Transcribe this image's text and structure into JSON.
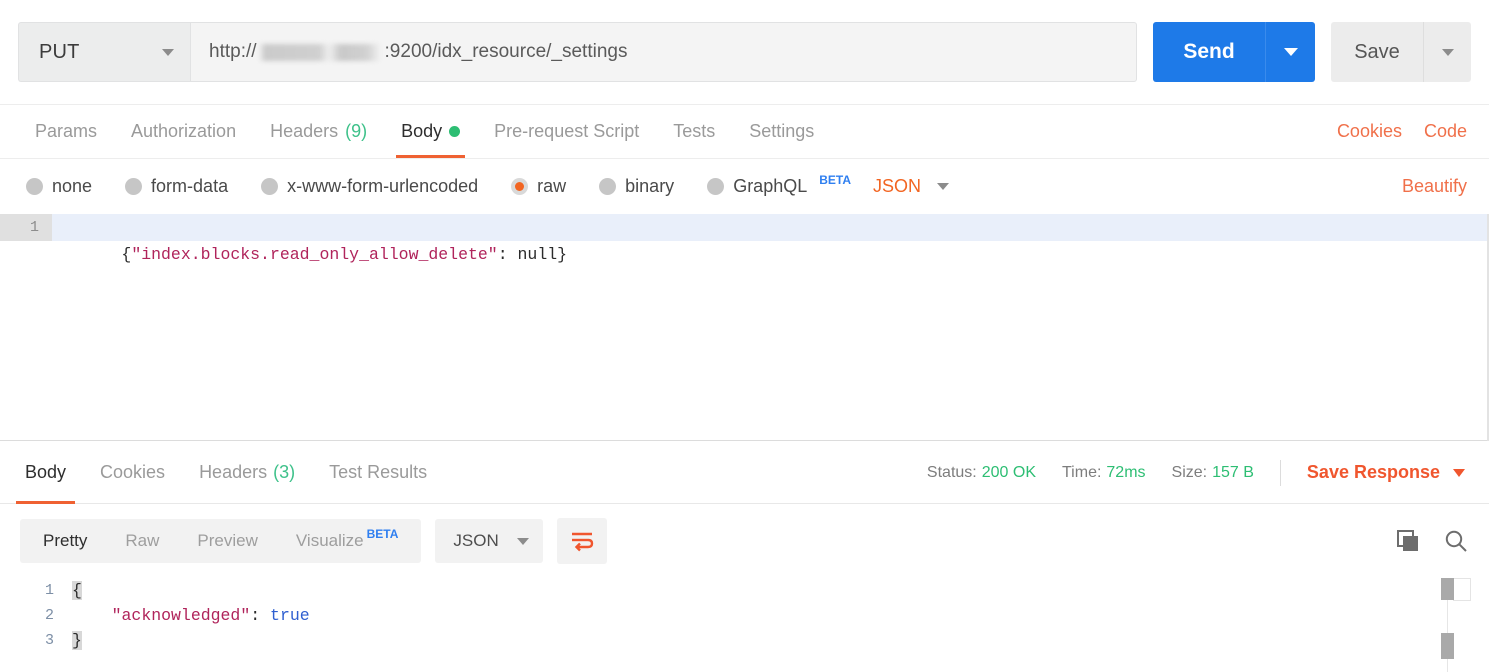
{
  "request_bar": {
    "method": "PUT",
    "method_caret_icon": "chevron-down-icon",
    "url_prefix": "http://",
    "url_suffix": ":9200/idx_resource/_settings",
    "url_placeholder": "Enter request URL",
    "send_label": "Send",
    "send_caret_icon": "chevron-down-icon",
    "save_label": "Save",
    "save_caret_icon": "chevron-down-icon"
  },
  "request_tabs": {
    "items": [
      {
        "label": "Params",
        "count": "",
        "active": false
      },
      {
        "label": "Authorization",
        "count": "",
        "active": false
      },
      {
        "label": "Headers",
        "count": "(9)",
        "active": false
      },
      {
        "label": "Body",
        "count": "",
        "active": true,
        "dot": true
      },
      {
        "label": "Pre-request Script",
        "count": "",
        "active": false
      },
      {
        "label": "Tests",
        "count": "",
        "active": false
      },
      {
        "label": "Settings",
        "count": "",
        "active": false
      }
    ],
    "cookies_label": "Cookies",
    "code_label": "Code"
  },
  "body_mode": {
    "options": [
      {
        "label": "none",
        "selected": false
      },
      {
        "label": "form-data",
        "selected": false
      },
      {
        "label": "x-www-form-urlencoded",
        "selected": false
      },
      {
        "label": "raw",
        "selected": true
      },
      {
        "label": "binary",
        "selected": false
      },
      {
        "label": "GraphQL",
        "selected": false,
        "badge": "BETA"
      }
    ],
    "format_label": "JSON",
    "format_caret_icon": "chevron-down-icon",
    "beautify_label": "Beautify"
  },
  "request_editor": {
    "lines": [
      {
        "number": "1",
        "active": true,
        "tokens": [
          {
            "text": "{",
            "type": "punct"
          },
          {
            "text": "\"index.blocks.read_only_allow_delete\"",
            "type": "string"
          },
          {
            "text": ":",
            "type": "punct"
          },
          {
            "text": " ",
            "type": "punct"
          },
          {
            "text": "null",
            "type": "null"
          },
          {
            "text": "}",
            "type": "punct"
          }
        ]
      }
    ]
  },
  "response_tabs": {
    "items": [
      {
        "label": "Body",
        "count": "",
        "active": true
      },
      {
        "label": "Cookies",
        "count": "",
        "active": false
      },
      {
        "label": "Headers",
        "count": "(3)",
        "active": false
      },
      {
        "label": "Test Results",
        "count": "",
        "active": false
      }
    ],
    "status_label": "Status:",
    "status_value": "200 OK",
    "time_label": "Time:",
    "time_value": "72ms",
    "size_label": "Size:",
    "size_value": "157 B",
    "save_response_label": "Save Response",
    "save_response_caret_icon": "chevron-down-icon"
  },
  "response_toolbar": {
    "views": [
      {
        "label": "Pretty",
        "active": true
      },
      {
        "label": "Raw",
        "active": false
      },
      {
        "label": "Preview",
        "active": false
      },
      {
        "label": "Visualize",
        "active": false,
        "badge": "BETA"
      }
    ],
    "format_label": "JSON",
    "format_caret_icon": "chevron-down-icon",
    "wrap_icon": "word-wrap-icon",
    "copy_icon": "copy-icon",
    "search_icon": "search-icon"
  },
  "response_body": {
    "lines": [
      {
        "number": "1",
        "tokens": [
          {
            "text": "{",
            "type": "punct-hl"
          }
        ]
      },
      {
        "number": "2",
        "tokens": [
          {
            "text": "    ",
            "type": "punct"
          },
          {
            "text": "\"acknowledged\"",
            "type": "string"
          },
          {
            "text": ":",
            "type": "punct"
          },
          {
            "text": " ",
            "type": "punct"
          },
          {
            "text": "true",
            "type": "bool"
          }
        ]
      },
      {
        "number": "3",
        "tokens": [
          {
            "text": "}",
            "type": "punct-hl"
          }
        ]
      }
    ]
  },
  "colors": {
    "accent_orange": "#ef6132",
    "send_blue": "#1e7ae8",
    "status_green": "#2dbe73",
    "string_red": "#b0245b",
    "bool_blue": "#2f5fd0",
    "beta_blue": "#2f7ff0"
  }
}
